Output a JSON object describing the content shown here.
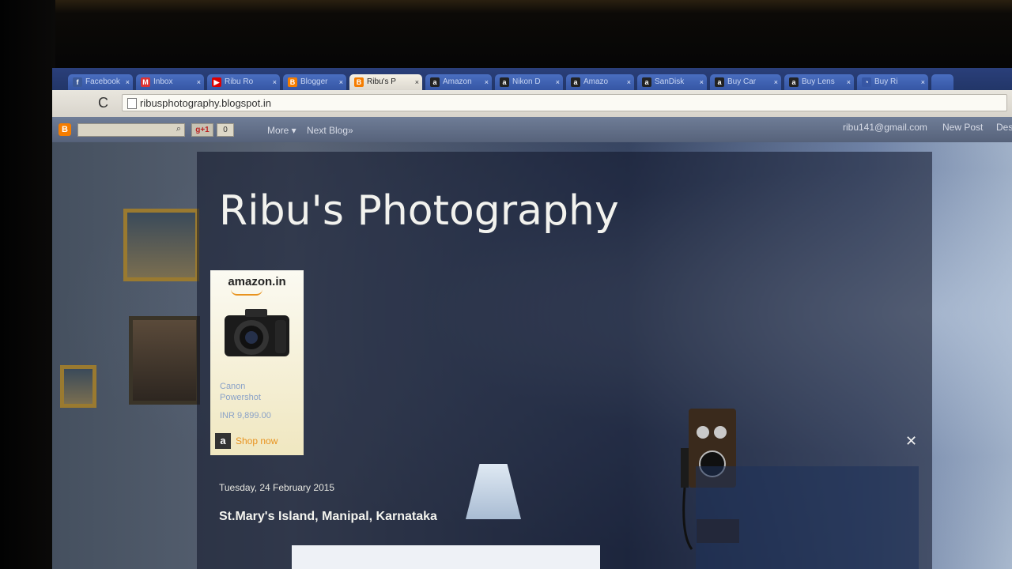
{
  "browser": {
    "tabs": [
      {
        "label": "Facebook",
        "icon": "facebook-icon",
        "fav": "f",
        "color": "#3b5998",
        "active": false
      },
      {
        "label": "Inbox",
        "icon": "gmail-icon",
        "fav": "M",
        "color": "#d33",
        "active": false
      },
      {
        "label": "Ribu Ro",
        "icon": "youtube-icon",
        "fav": "▶",
        "color": "#d00",
        "active": false
      },
      {
        "label": "Blogger",
        "icon": "blogger-icon",
        "fav": "B",
        "color": "#f57d00",
        "active": false
      },
      {
        "label": "Ribu's P",
        "icon": "blogger-icon",
        "fav": "B",
        "color": "#f57d00",
        "active": true
      },
      {
        "label": "Amazon",
        "icon": "amazon-icon",
        "fav": "a",
        "color": "#222",
        "active": false
      },
      {
        "label": "Nikon D",
        "icon": "amazon-icon",
        "fav": "a",
        "color": "#222",
        "active": false
      },
      {
        "label": "Amazo",
        "icon": "amazon-icon",
        "fav": "a",
        "color": "#222",
        "active": false
      },
      {
        "label": "SanDisk",
        "icon": "amazon-icon",
        "fav": "a",
        "color": "#222",
        "active": false
      },
      {
        "label": "Buy Car",
        "icon": "amazon-icon",
        "fav": "a",
        "color": "#222",
        "active": false
      },
      {
        "label": "Buy Lens",
        "icon": "amazon-icon",
        "fav": "a",
        "color": "#222",
        "active": false
      },
      {
        "label": "Buy Ri",
        "icon": "loading-icon",
        "fav": "◔",
        "color": "#3656a4",
        "active": false
      }
    ],
    "close_glyph": "×",
    "url": "ribusphotography.blogspot.in",
    "reload_glyph": "C"
  },
  "blogger_bar": {
    "gplus": "g+1",
    "count": "0",
    "more": "More ▾",
    "next_blog": "Next Blog»",
    "email": "ribu141@gmail.com",
    "new_post": "New Post",
    "design": "Des"
  },
  "blog": {
    "title": "Ribu's Photography",
    "post_date": "Tuesday, 24 February 2015",
    "post_title": "St.Mary's Island, Manipal, Karnataka"
  },
  "ad": {
    "brand": "amazon.in",
    "product_line1": "Canon",
    "product_line2": "Powershot",
    "price": "INR 9,899.00",
    "shop": "Shop now",
    "shop_logo": "a"
  }
}
